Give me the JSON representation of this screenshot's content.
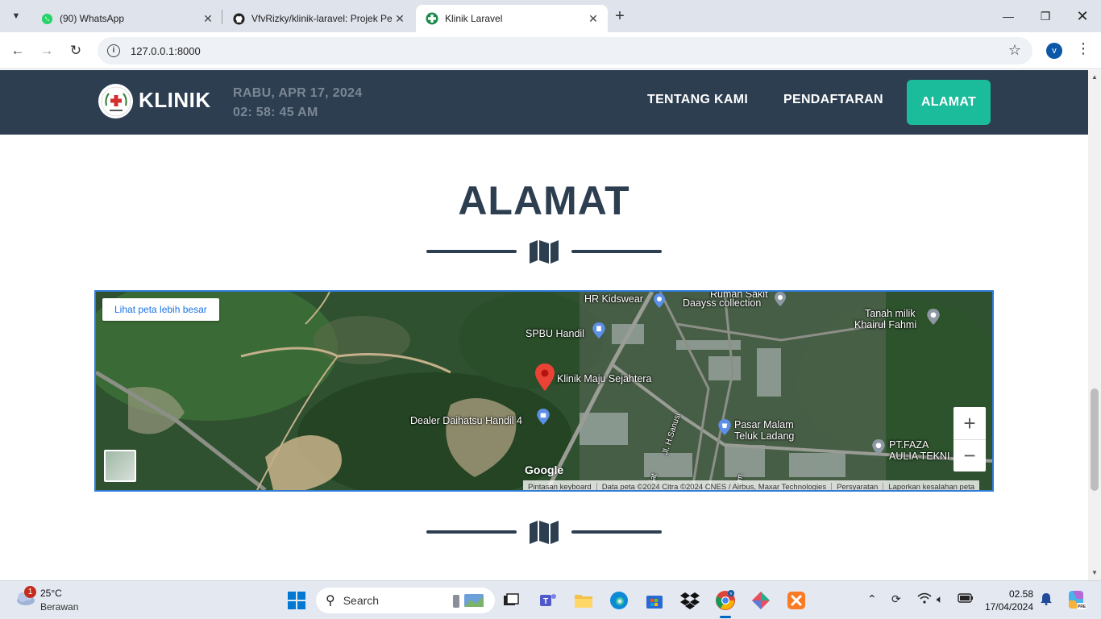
{
  "browser": {
    "tabs": [
      {
        "title": "(90) WhatsApp",
        "icon": "whatsapp-icon"
      },
      {
        "title": "VfvRizky/klinik-laravel: Projek Pe",
        "icon": "github-icon"
      },
      {
        "title": "Klinik Laravel",
        "icon": "clinic-cross-icon"
      }
    ],
    "url": "127.0.0.1:8000",
    "profile_initial": "v"
  },
  "site": {
    "brand": "KLINIK",
    "date": "RABU, APR 17, 2024",
    "time": "02: 58: 45 AM",
    "nav": [
      "TENTANG KAMI",
      "PENDAFTARAN",
      "ALAMAT"
    ],
    "heading": "ALAMAT",
    "colors": {
      "nav_bg": "#2c3e50",
      "accent": "#1abc9c"
    }
  },
  "map": {
    "larger_map_link": "Lihat peta lebih besar",
    "places": {
      "hr_kidswear": "HR Kidswear",
      "rumah_sakit": "Rumah Sakit",
      "daayss": "Daayss collection",
      "tanah_milik_1": "Tanah milik",
      "tanah_milik_2": "Khairul Fahmi",
      "spbu": "SPBU Handil",
      "klinik": "Klinik Maju Sejahtera",
      "dealer": "Dealer Daihatsu Handil 4",
      "pasar_1": "Pasar Malam",
      "pasar_2": "Teluk Ladang",
      "pt_1": "PT.FAZA",
      "pt_2": "AULIA TEKNI",
      "road_1": "Jl. H.Sanusi",
      "road_2": "jat",
      "road_3": "im"
    },
    "google": "Google",
    "attribution": [
      "Pintasan keyboard",
      "Data peta ©2024 Citra ©2024 CNES / Airbus, Maxar Technologies",
      "Persyaratan",
      "Laporkan kesalahan peta"
    ]
  },
  "taskbar": {
    "weather_badge": "1",
    "temperature": "25°C",
    "condition": "Berawan",
    "search_label": "Search",
    "time": "02.58",
    "date": "17/04/2024"
  }
}
